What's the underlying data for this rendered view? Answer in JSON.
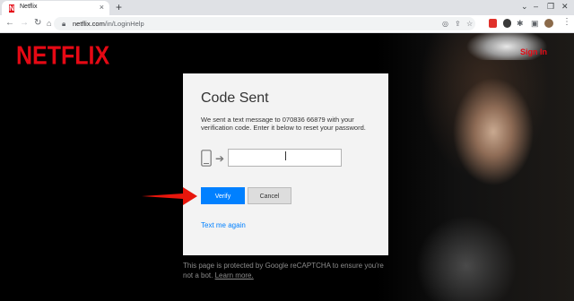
{
  "browser": {
    "tab_title": "Netflix",
    "tab_favicon_letter": "N",
    "url_host": "netflix.com",
    "url_path": "/in/LoginHelp"
  },
  "site": {
    "logo_text": "NETFLIX",
    "sign_in_label": "Sign In"
  },
  "card": {
    "title": "Code Sent",
    "message": "We sent a text message to 070836 66879 with your verification code. Enter it below to reset your password.",
    "code_value": "",
    "verify_label": "Verify",
    "cancel_label": "Cancel",
    "text_again_label": "Text me again"
  },
  "footer": {
    "recaptcha_text": "This page is protected by Google reCAPTCHA to ensure you're not a bot.",
    "learn_more_label": "Learn more."
  },
  "colors": {
    "brand_red": "#e50914",
    "primary_blue": "#0080ff"
  }
}
